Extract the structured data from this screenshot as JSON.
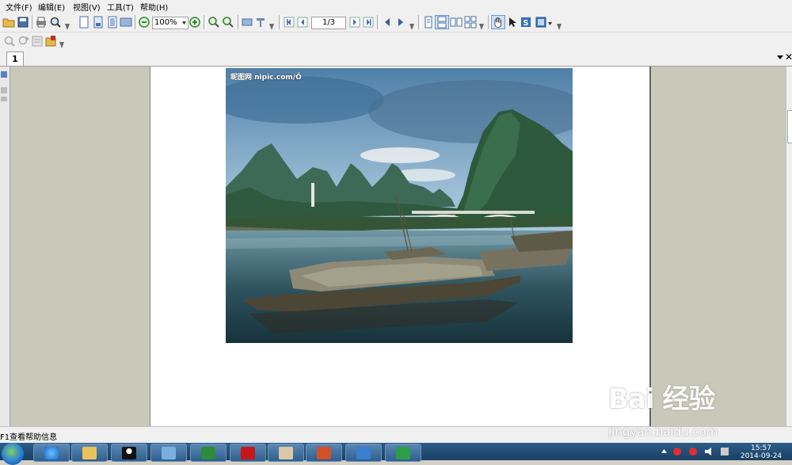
{
  "menubar": {
    "items": [
      "文件(F)",
      "编辑(E)",
      "视图(V)",
      "工具(T)",
      "帮助(H)"
    ]
  },
  "toolbar": {
    "zoom_value": "100%",
    "page_indicator": "1/3"
  },
  "tabs": [
    {
      "label": "1"
    }
  ],
  "document": {
    "photo_watermark": "昵图网 nipic.com/Ö"
  },
  "status": {
    "text": "F1查看帮助信息"
  },
  "watermark": {
    "logo": "Bai 经验",
    "url": "jingyan.baidu.com"
  },
  "clock": {
    "time": "15:57",
    "date": "2014-09-24"
  },
  "colors": {
    "workspace": "#c8c9b8",
    "taskbar": "#1f4a74",
    "toolbar": "#f0f0f0"
  }
}
